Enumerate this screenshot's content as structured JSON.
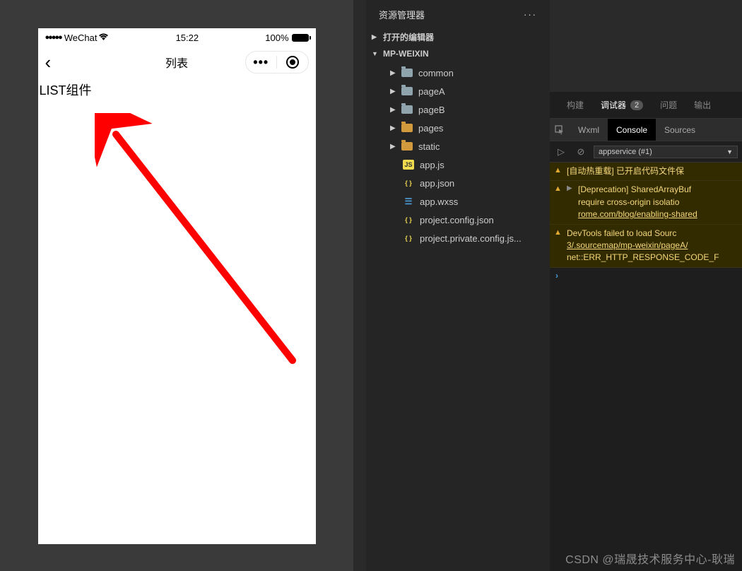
{
  "simulator": {
    "carrier": "WeChat",
    "time": "15:22",
    "battery": "100%",
    "nav_title": "列表",
    "page_text": "LIST组件"
  },
  "explorer": {
    "title": "资源管理器",
    "sections": {
      "editors": "打开的编辑器",
      "project": "MP-WEIXIN"
    },
    "tree": [
      {
        "name": "common",
        "type": "folder"
      },
      {
        "name": "pageA",
        "type": "folder"
      },
      {
        "name": "pageB",
        "type": "folder"
      },
      {
        "name": "pages",
        "type": "folder-orange"
      },
      {
        "name": "static",
        "type": "folder-orange"
      },
      {
        "name": "app.js",
        "type": "js"
      },
      {
        "name": "app.json",
        "type": "json"
      },
      {
        "name": "app.wxss",
        "type": "wxss"
      },
      {
        "name": "project.config.json",
        "type": "json"
      },
      {
        "name": "project.private.config.js...",
        "type": "json"
      }
    ]
  },
  "devtools": {
    "tabs1": {
      "build": "构建",
      "debugger": "调试器",
      "badge": "2",
      "issues": "问题",
      "output": "输出"
    },
    "tabs2": {
      "wxml": "Wxml",
      "console": "Console",
      "sources": "Sources"
    },
    "context": "appservice (#1)",
    "messages": [
      {
        "expandable": false,
        "text": "[自动热重载] 已开启代码文件保"
      },
      {
        "expandable": true,
        "text": "[Deprecation] SharedArrayBuf",
        "line2": "require cross-origin isolatio",
        "link": "rome.com/blog/enabling-shared"
      },
      {
        "expandable": false,
        "text": "DevTools failed to load Sourc",
        "link": "3/.sourcemap/mp-weixin/pageA/",
        "line3": "net::ERR_HTTP_RESPONSE_CODE_F"
      }
    ]
  },
  "watermark": "CSDN @瑞晟技术服务中心-耿瑞"
}
